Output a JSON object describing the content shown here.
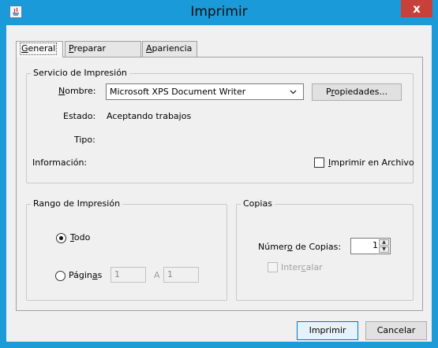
{
  "window": {
    "title": "Imprimir",
    "close_label": "x"
  },
  "tabs": [
    {
      "label": "General",
      "mnemonic": "G",
      "rest": "eneral"
    },
    {
      "label": "Preparar Página",
      "mnemonic": "P",
      "rest": "reparar Página"
    },
    {
      "label": "Apariencia",
      "mnemonic": "A",
      "rest": "pariencia"
    }
  ],
  "print_service": {
    "title": "Servicio de Impresión",
    "name_label_mn": "N",
    "name_label_rest": "ombre:",
    "printer_selected": "Microsoft XPS Document Writer",
    "properties_pre": "P",
    "properties_mn": "r",
    "properties_post": "opiedades...",
    "status_label": "Estado:",
    "status_value": "Aceptando trabajos",
    "type_label": "Tipo:",
    "info_label": "Información:",
    "print_to_file_mn": "I",
    "print_to_file_rest": "mprimir en Archivo"
  },
  "print_range": {
    "title": "Rango de Impresión",
    "all_mn": "T",
    "all_rest": "odo",
    "pages_pre": "Págin",
    "pages_mn": "a",
    "pages_post": "s",
    "from": "1",
    "to_label": "A",
    "to": "1"
  },
  "copies": {
    "title": "Copias",
    "count_pre": "Númer",
    "count_mn": "o",
    "count_post": " de Copias:",
    "count": "1",
    "collate_pre": "Inter",
    "collate_mn": "c",
    "collate_post": "alar"
  },
  "footer": {
    "print_label": "Imprimir",
    "cancel_label": "Cancelar"
  }
}
